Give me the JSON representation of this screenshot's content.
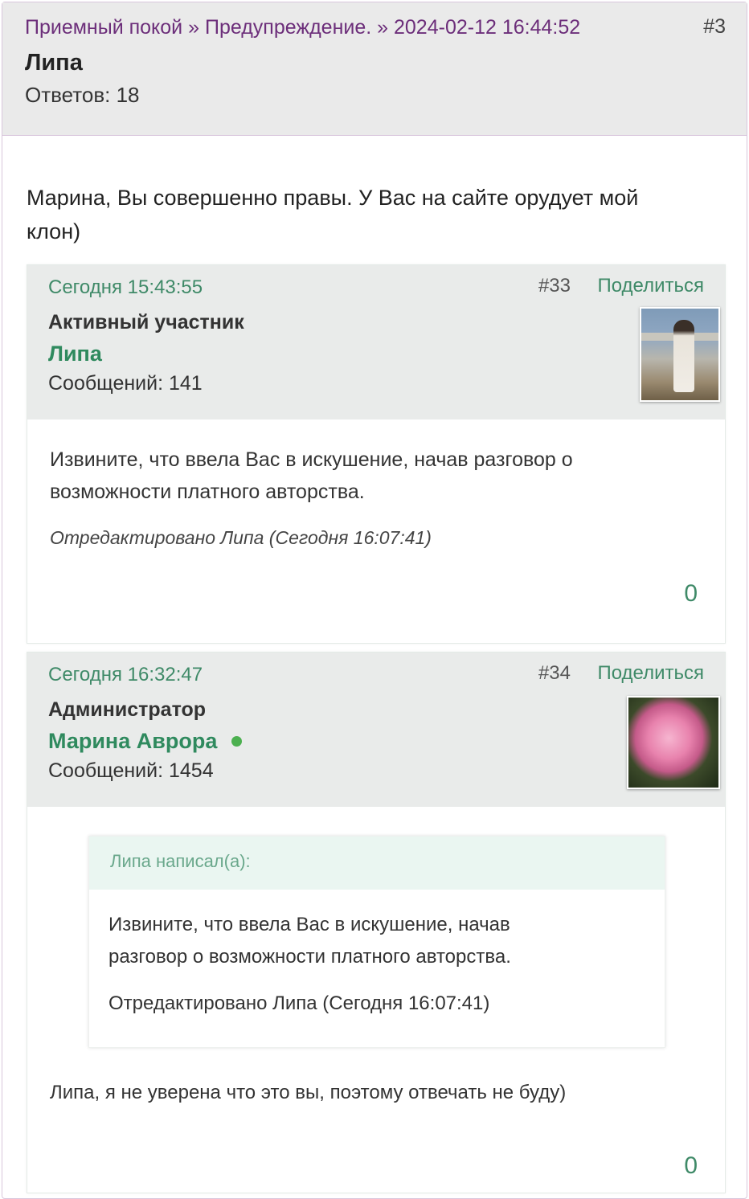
{
  "topic": {
    "breadcrumb": [
      "Приемный покой",
      "Предупреждение.",
      "2024-02-12 16:44:52"
    ],
    "breadcrumb_sep": "»",
    "post_number": "#3",
    "author": "Липа",
    "replies": "Ответов: 18",
    "text": "Марина, Вы совершенно правы. У Вас на сайте орудует мой клон)"
  },
  "posts": [
    {
      "date": "Сегодня 15:43:55",
      "number": "#33",
      "share": "Поделиться",
      "role": "Активный участник",
      "name": "Липа",
      "messages": "Сообщений: 141",
      "avatar_icon": "user-avatar-photo",
      "text": "Извините, что ввела Вас в искушение, начав разговор  о возможности платного авторства.",
      "edited": "Отредактировано Липа (Сегодня 16:07:41)",
      "likes": "0"
    },
    {
      "date": "Сегодня 16:32:47",
      "number": "#34",
      "share": "Поделиться",
      "role": "Администратор",
      "name": "Марина Аврора",
      "messages": "Сообщений: 1454",
      "online": true,
      "avatar_icon": "user-avatar-rose",
      "quote": {
        "header": "Липа написал(а):",
        "text": "Извините, что ввела Вас в искушение, начав разговор  о возможности платного авторства.",
        "edited": "Отредактировано Липа (Сегодня 16:07:41)"
      },
      "text": "Липа, я не уверена что это вы, поэтому отвечать не буду)",
      "likes": "0"
    }
  ],
  "colors": {
    "breadcrumb": "#6c2e7a",
    "accent_green": "#3f8a68",
    "online": "#4cb050"
  }
}
